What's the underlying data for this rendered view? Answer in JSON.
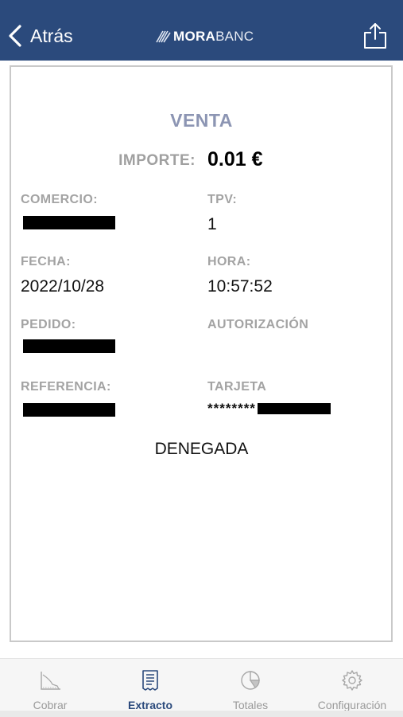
{
  "nav": {
    "back_label": "Atrás",
    "logo_bold": "MORA",
    "logo_light": "BANC"
  },
  "receipt": {
    "title": "VENTA",
    "amount_label": "IMPORTE:",
    "amount_value": "0.01 €",
    "fields": {
      "comercio_label": "COMERCIO:",
      "tpv_label": "TPV:",
      "tpv_value": "1",
      "fecha_label": "FECHA:",
      "fecha_value": "2022/10/28",
      "hora_label": "HORA:",
      "hora_value": "10:57:52",
      "pedido_label": "PEDIDO:",
      "autorizacion_label": "AUTORIZACIÓN",
      "referencia_label": "REFERENCIA:",
      "tarjeta_label": "TARJETA",
      "tarjeta_masked_prefix": "********"
    },
    "status": "DENEGADA"
  },
  "tabs": [
    {
      "label": "Cobrar",
      "icon": "chart-slope-icon",
      "active": false
    },
    {
      "label": "Extracto",
      "icon": "receipt-icon",
      "active": true
    },
    {
      "label": "Totales",
      "icon": "pie-chart-icon",
      "active": false
    },
    {
      "label": "Configuración",
      "icon": "gear-icon",
      "active": false
    }
  ],
  "colors": {
    "navbar": "#2b4a7c",
    "title": "#8c95b3",
    "label_gray": "#a3a3a3",
    "tab_active": "#2b4a7c",
    "tab_inactive": "#9a9a9a"
  }
}
